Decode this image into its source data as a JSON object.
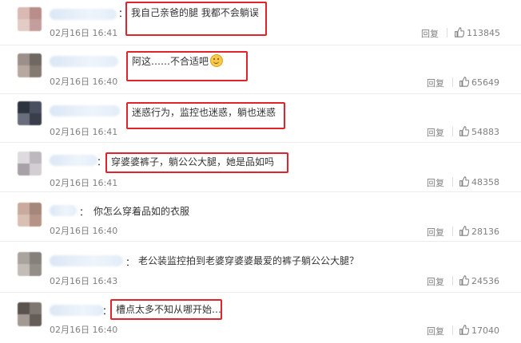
{
  "comments": [
    {
      "text": "我自己亲爸的腿 我都不会躺误",
      "time": "02月16日 16:41",
      "reply": "回复",
      "likes": "113845",
      "highlighted": true,
      "emoji": false
    },
    {
      "text": "阿这……不合适吧",
      "time": "02月16日 16:40",
      "reply": "回复",
      "likes": "65649",
      "highlighted": true,
      "emoji": true,
      "emoji_icon": "smile-emoji-icon"
    },
    {
      "text": "迷惑行为，监控也迷惑，躺也迷惑",
      "time": "02月16日 16:41",
      "reply": "回复",
      "likes": "54883",
      "highlighted": true,
      "emoji": false
    },
    {
      "text": "穿婆婆裤子，躺公公大腿，她是品如吗",
      "time": "02月16日 16:41",
      "reply": "回复",
      "likes": "48358",
      "highlighted": true,
      "emoji": false
    },
    {
      "text": "你怎么穿着品如的衣服",
      "time": "02月16日 16:40",
      "reply": "回复",
      "likes": "28136",
      "highlighted": false,
      "emoji": false
    },
    {
      "text": "老公装监控拍到老婆穿婆婆最爱的裤子躺公公大腿？",
      "time": "02月16日 16:43",
      "reply": "回复",
      "likes": "24536",
      "highlighted": false,
      "emoji": false
    },
    {
      "text": "槽点太多不知从哪开始…",
      "time": "02月16日 16:40",
      "reply": "回复",
      "likes": "17040",
      "highlighted": true,
      "emoji": false
    }
  ],
  "colon": "：",
  "colors": {
    "highlight": "#e0242d",
    "meta": "#808080",
    "text": "#333333"
  },
  "like_icon": "thumbs-up-icon"
}
